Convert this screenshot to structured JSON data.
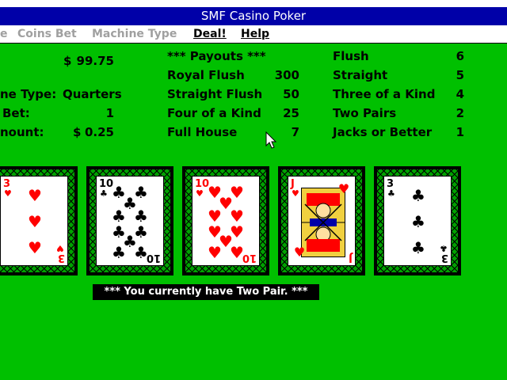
{
  "window": {
    "title": "SMF Casino Poker"
  },
  "menu": {
    "items": [
      {
        "label": "e",
        "enabled": false
      },
      {
        "label": "Coins Bet",
        "enabled": false
      },
      {
        "label": "Machine Type",
        "enabled": false
      },
      {
        "label": "Deal!",
        "enabled": true
      },
      {
        "label": "Help",
        "enabled": true
      }
    ]
  },
  "info": {
    "credits_prefix": "$",
    "credits_value": "99.75",
    "machine_type_label": "ne Type:",
    "machine_type_value": "Quarters",
    "bet_label": "Bet:",
    "bet_value": "1",
    "amount_label": "nount:",
    "amount_prefix": "$",
    "amount_value": "0.25"
  },
  "payouts": {
    "header": "*** Payouts ***",
    "left": [
      {
        "hand": "Royal Flush",
        "payout": "300"
      },
      {
        "hand": "Straight Flush",
        "payout": "50"
      },
      {
        "hand": "Four of a Kind",
        "payout": "25"
      },
      {
        "hand": "Full House",
        "payout": "7"
      }
    ],
    "right": [
      {
        "hand": "Flush",
        "payout": "6"
      },
      {
        "hand": "Straight",
        "payout": "5"
      },
      {
        "hand": "Three of a Kind",
        "payout": "4"
      },
      {
        "hand": "Two Pairs",
        "payout": "2"
      },
      {
        "hand": "Jacks or Better",
        "payout": "1"
      }
    ]
  },
  "cards": [
    {
      "rank": "3",
      "suit": "♥",
      "color": "red"
    },
    {
      "rank": "10",
      "suit": "♣",
      "color": "black"
    },
    {
      "rank": "10",
      "suit": "♥",
      "color": "red"
    },
    {
      "rank": "J",
      "suit": "♥",
      "color": "red"
    },
    {
      "rank": "3",
      "suit": "♣",
      "color": "black"
    }
  ],
  "status": {
    "message": "*** You currently have Two Pair. ***"
  },
  "colors": {
    "table": "#00c000",
    "title_bar": "#0000a8",
    "red_suit": "#ff0000"
  }
}
